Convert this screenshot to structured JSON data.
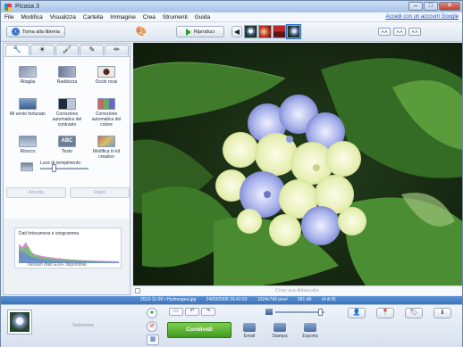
{
  "window": {
    "title": "Picasa 3",
    "controls": {
      "minimize": "–",
      "maximize": "□",
      "close": "✕"
    }
  },
  "menu": {
    "items": [
      "File",
      "Modifica",
      "Visualizza",
      "Cartella",
      "Immagine",
      "Crea",
      "Strumenti",
      "Guida"
    ],
    "signin": "Accedi con un account Google"
  },
  "toolbar": {
    "back_label": "Torna alla libreria",
    "play_label": "Riproduci",
    "size_buttons": [
      "A A",
      "A A",
      "A A"
    ]
  },
  "edit_tabs": [
    {
      "icon": "wrench-icon",
      "glyph": "🔧"
    },
    {
      "icon": "sun-icon",
      "glyph": "☀"
    },
    {
      "icon": "brush-icon",
      "glyph": "🖌"
    },
    {
      "icon": "pen-icon",
      "glyph": "✎"
    },
    {
      "icon": "pencil-icon",
      "glyph": "✏"
    }
  ],
  "tools": [
    {
      "label": "Ritaglia",
      "icon": "crop-icon"
    },
    {
      "label": "Raddrizza",
      "icon": "straighten-icon"
    },
    {
      "label": "Occhi rossi",
      "icon": "red-eye-icon"
    },
    {
      "label": "Mi sento fortunato",
      "icon": "lucky-icon"
    },
    {
      "label": "Correzione automatica del contrasto",
      "icon": "auto-contrast-icon"
    },
    {
      "label": "Correzione automatica del colore",
      "icon": "auto-color-icon"
    },
    {
      "label": "Ritocco",
      "icon": "retouch-icon"
    },
    {
      "label": "Testo",
      "icon": "text-icon",
      "glyph": "ABC"
    },
    {
      "label": "Modifica in kit creativo",
      "icon": "creative-kit-icon"
    }
  ],
  "fill_light": {
    "label": "Luce di riempimento",
    "value": 0.28
  },
  "undo_label": "Annulla",
  "redo_label": "Ripeti",
  "info_panel": {
    "title": "Dati fotocamera e istogramma",
    "note": "Nessun dato EXIF disponibile."
  },
  "caption_placeholder": "Crea una didascalia.",
  "status": {
    "filename": "2012-11-09 • Hydrangea.jpg",
    "date": "24/03/2006 16:41:53",
    "dimensions": "1024x768 pixel",
    "filesize": "581 kB",
    "position": "(4 di 8)"
  },
  "tray": {
    "selection_label": "Selezione",
    "share_label": "Condividi",
    "actions": [
      {
        "label": "Email",
        "icon": "email-icon"
      },
      {
        "label": "Stampa",
        "icon": "print-icon"
      },
      {
        "label": "Esporta",
        "icon": "export-icon"
      }
    ],
    "zoom": 0.9,
    "right_buttons": [
      {
        "icon": "person-icon",
        "glyph": "👤"
      },
      {
        "icon": "map-pin-icon",
        "glyph": "📍"
      },
      {
        "icon": "tag-icon",
        "glyph": "🏷"
      },
      {
        "icon": "info-icon",
        "glyph": "ℹ"
      }
    ]
  }
}
